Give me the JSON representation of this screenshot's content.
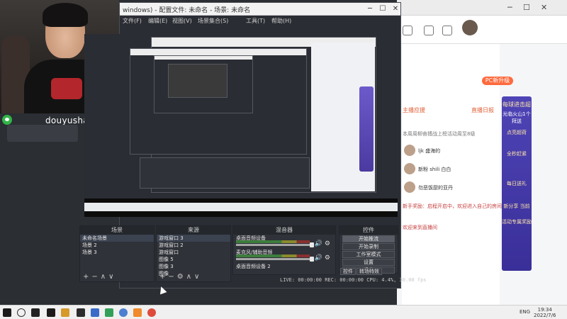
{
  "streamer": {
    "username": "douyushanshanya"
  },
  "obs": {
    "window_title": "windows) - 配置文件: 未命名 - 场景: 未命名",
    "menu": [
      "文件(F)",
      "编辑(E)",
      "视图(V)",
      "场景集合(S)",
      "工具(T)",
      "帮助(H)"
    ],
    "docks": {
      "scenes": {
        "title": "场景",
        "items": [
          "未命名场景",
          "场景 2",
          "场景 3"
        ]
      },
      "sources": {
        "title": "来源",
        "items": [
          "游戏窗口 3",
          "游戏窗口 2",
          "游戏窗口",
          "图像 5",
          "图像 3",
          "图像"
        ]
      },
      "mixer": {
        "title": "混音器",
        "channels": [
          "桌面音频设备",
          "麦克风/辅助音频",
          "桌面音频设备 2"
        ]
      },
      "controls": {
        "title": "控件",
        "buttons": [
          "开始推流",
          "开始录制",
          "工作室模式",
          "设置",
          "退出"
        ]
      }
    },
    "bottom_tabs": [
      "控件",
      "转场特效"
    ],
    "status": "LIVE: 00:00:00   REC: 00:00:00   CPU: 4.4%, 30.00 fps"
  },
  "douyu": {
    "pc_badge": "PC新升级",
    "right_panel": {
      "title": "每球进击超",
      "line2": "光临火山1个拜送",
      "line3": "点亮超荷",
      "line4": "全秒赶紧",
      "line5": "每日送礼",
      "line6": "新分享 当前",
      "line7": "活动专属奖励"
    },
    "chat": [
      "主播应援",
      "直播日报",
      "本周周柳奋搏战上榜活动周至8级",
      "ljk 盛海的",
      "新粉 shili 白白",
      "勿恶饭厨的亚丹",
      "新手奖励：启程开启中，欢迎进入自己的房间",
      "欢迎来到直播间"
    ]
  },
  "taskbar": {
    "lang": "ENG",
    "time": "19:34",
    "date": "2022/7/6"
  }
}
